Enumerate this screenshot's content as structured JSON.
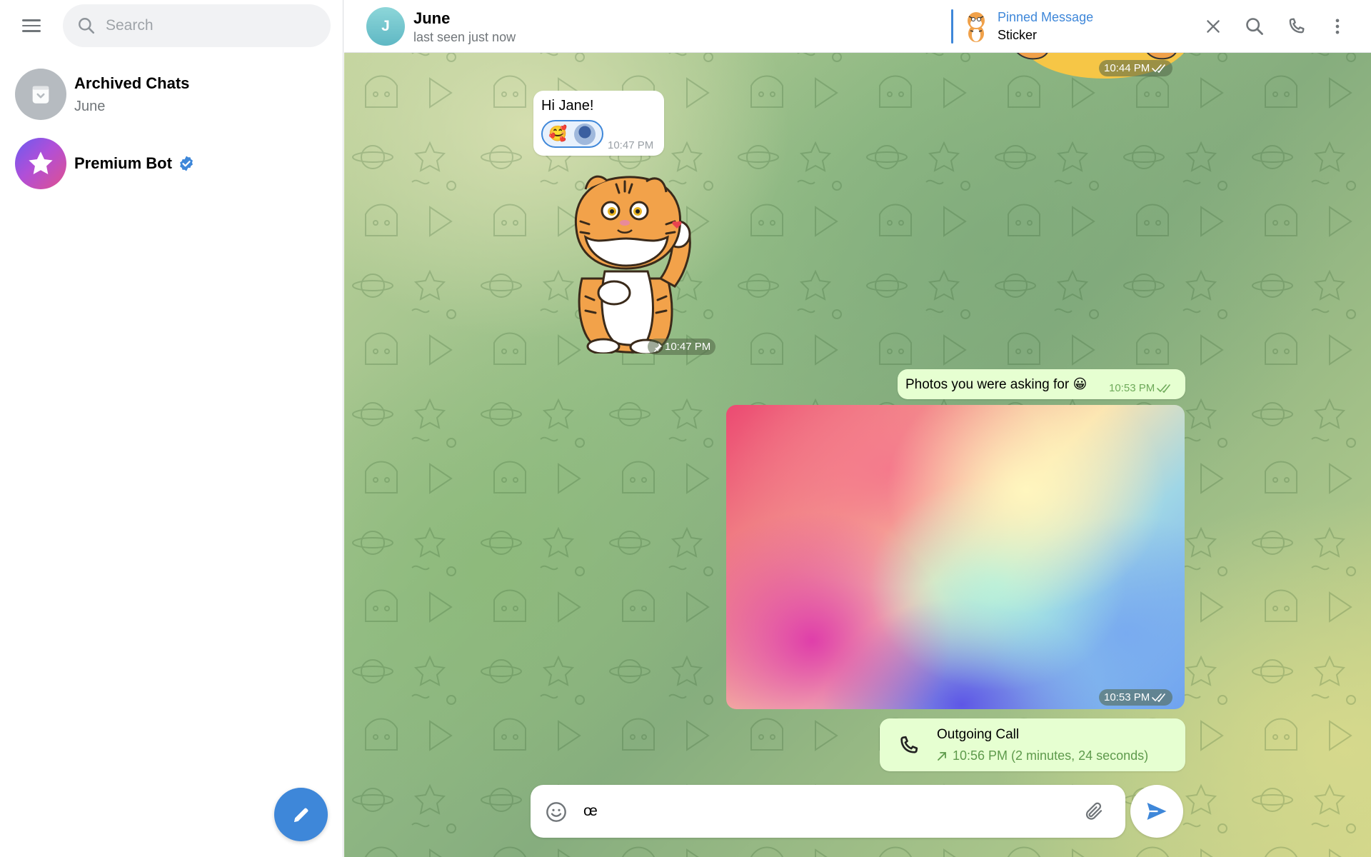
{
  "sidebar": {
    "search": {
      "placeholder": "Search",
      "value": ""
    },
    "chats": [
      {
        "title": "Archived Chats",
        "subtitle": "June",
        "icon": "archive-icon"
      },
      {
        "title": "Premium Bot",
        "subtitle": "",
        "icon": "star-icon",
        "verified": true
      }
    ],
    "compose_icon": "pencil-icon"
  },
  "chat": {
    "peer": {
      "initial": "J",
      "name": "June",
      "status": "last seen just now"
    },
    "pinned": {
      "title": "Pinned Message",
      "subtitle": "Sticker"
    },
    "header_icons": [
      "close-icon",
      "search-icon",
      "phone-icon",
      "more-vertical-icon"
    ],
    "messages": {
      "top_sticker_time": "10:44 PM",
      "hi": {
        "text": "Hi Jane!",
        "time": "10:47 PM",
        "reaction": "🥰"
      },
      "tiger_sticker_time": "10:47 PM",
      "photos": {
        "text": "Photos you were asking for 😀",
        "time": "10:53 PM"
      },
      "photo_time": "10:53 PM",
      "call": {
        "title": "Outgoing Call",
        "detail": "10:56 PM (2 minutes, 24 seconds)"
      }
    },
    "composer": {
      "value": "œ",
      "placeholder": ""
    }
  },
  "colors": {
    "accent": "#3e87d9",
    "outgoing_bubble": "#e6ffd1",
    "incoming_bubble": "#ffffff"
  }
}
